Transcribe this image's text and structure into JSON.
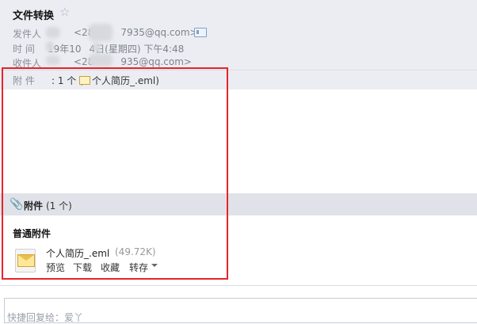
{
  "mail": {
    "subject": "文件转换",
    "sender": {
      "label": "发件人",
      "email": "<28",
      "email_tail": "7935@qq.com>"
    },
    "time": {
      "label": "时   间",
      "value": "19年10",
      "value_tail": "4日(星期四) 下午4:48"
    },
    "recipient": {
      "label": "收件人",
      "email": "<28",
      "email_tail": "935@qq.com>"
    },
    "attachment_summary": {
      "label": "附   件",
      "count": ": 1 个 (",
      "file_name": "个人简历_.eml)"
    }
  },
  "attachments_section": {
    "title": "附件",
    "count": "(1 个)",
    "group_heading": "普通附件",
    "file": {
      "name": "个人简历_.eml",
      "size": "(49.72K)",
      "actions": [
        "预览",
        "下载",
        "收藏",
        "转存"
      ]
    }
  },
  "reply": {
    "placeholder": "快捷回复给：爱丫"
  },
  "colors": {
    "highlight_box": "#e8232a",
    "header_bg": "#ebedf2"
  }
}
